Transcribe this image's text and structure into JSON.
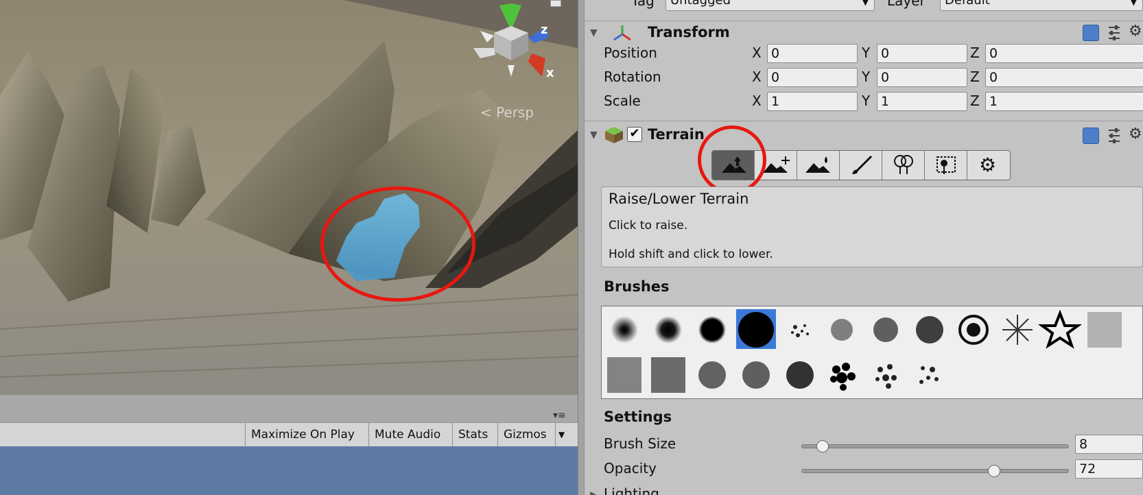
{
  "scene": {
    "persp_label": "Persp",
    "axis_y": "",
    "axis_z": "z",
    "axis_x": "x"
  },
  "game_toolbar": {
    "maximize_label": "Maximize On Play",
    "mute_label": "Mute Audio",
    "stats_label": "Stats",
    "gizmos_label": "Gizmos"
  },
  "inspector": {
    "tag_label": "Tag",
    "tag_value": "Untagged",
    "layer_label": "Layer",
    "layer_value": "Default",
    "transform": {
      "title": "Transform",
      "rows": [
        {
          "label": "Position",
          "x": "0",
          "y": "0",
          "z": "0"
        },
        {
          "label": "Rotation",
          "x": "0",
          "y": "0",
          "z": "0"
        },
        {
          "label": "Scale",
          "x": "1",
          "y": "1",
          "z": "1"
        }
      ],
      "axis_x": "X",
      "axis_y": "Y",
      "axis_z": "Z"
    },
    "terrain": {
      "title": "Terrain",
      "enabled": true,
      "tools": [
        "raise-lower-icon",
        "paint-height-icon",
        "smooth-height-icon",
        "paint-texture-icon",
        "place-trees-icon",
        "paint-details-icon",
        "terrain-settings-icon"
      ],
      "active_tool": 0,
      "help_title": "Raise/Lower Terrain",
      "help_line1": "Click to raise.",
      "help_line2": "Hold shift and click to lower.",
      "brushes_label": "Brushes",
      "selected_brush": 3,
      "settings_label": "Settings",
      "brush_size_label": "Brush Size",
      "brush_size_value": "8",
      "brush_size_fraction": 0.08,
      "opacity_label": "Opacity",
      "opacity_value": "72",
      "opacity_fraction": 0.72,
      "lighting_label": "Lighting"
    }
  },
  "colors": {
    "highlight_red": "#e8170f",
    "water_blue": "#5aa9d6",
    "selection_blue": "#3b78d8"
  }
}
